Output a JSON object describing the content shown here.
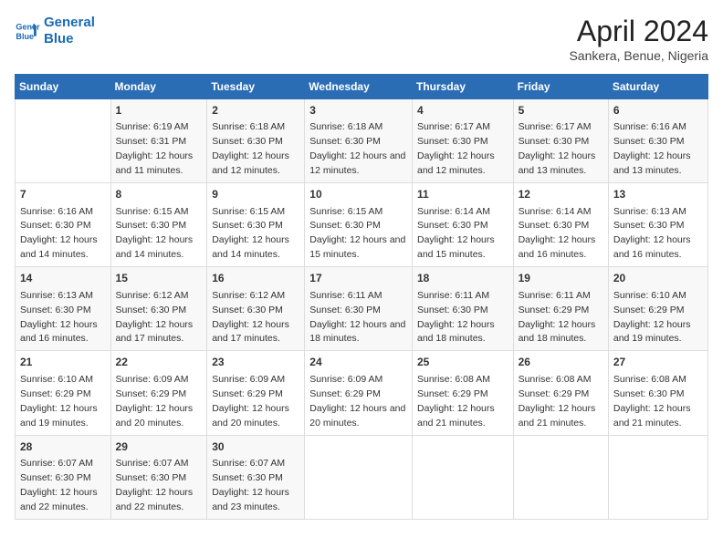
{
  "header": {
    "logo_line1": "General",
    "logo_line2": "Blue",
    "month": "April 2024",
    "location": "Sankera, Benue, Nigeria"
  },
  "columns": [
    "Sunday",
    "Monday",
    "Tuesday",
    "Wednesday",
    "Thursday",
    "Friday",
    "Saturday"
  ],
  "rows": [
    [
      {
        "day": "",
        "sunrise": "",
        "sunset": "",
        "daylight": ""
      },
      {
        "day": "1",
        "sunrise": "Sunrise: 6:19 AM",
        "sunset": "Sunset: 6:31 PM",
        "daylight": "Daylight: 12 hours and 11 minutes."
      },
      {
        "day": "2",
        "sunrise": "Sunrise: 6:18 AM",
        "sunset": "Sunset: 6:30 PM",
        "daylight": "Daylight: 12 hours and 12 minutes."
      },
      {
        "day": "3",
        "sunrise": "Sunrise: 6:18 AM",
        "sunset": "Sunset: 6:30 PM",
        "daylight": "Daylight: 12 hours and 12 minutes."
      },
      {
        "day": "4",
        "sunrise": "Sunrise: 6:17 AM",
        "sunset": "Sunset: 6:30 PM",
        "daylight": "Daylight: 12 hours and 12 minutes."
      },
      {
        "day": "5",
        "sunrise": "Sunrise: 6:17 AM",
        "sunset": "Sunset: 6:30 PM",
        "daylight": "Daylight: 12 hours and 13 minutes."
      },
      {
        "day": "6",
        "sunrise": "Sunrise: 6:16 AM",
        "sunset": "Sunset: 6:30 PM",
        "daylight": "Daylight: 12 hours and 13 minutes."
      }
    ],
    [
      {
        "day": "7",
        "sunrise": "Sunrise: 6:16 AM",
        "sunset": "Sunset: 6:30 PM",
        "daylight": "Daylight: 12 hours and 14 minutes."
      },
      {
        "day": "8",
        "sunrise": "Sunrise: 6:15 AM",
        "sunset": "Sunset: 6:30 PM",
        "daylight": "Daylight: 12 hours and 14 minutes."
      },
      {
        "day": "9",
        "sunrise": "Sunrise: 6:15 AM",
        "sunset": "Sunset: 6:30 PM",
        "daylight": "Daylight: 12 hours and 14 minutes."
      },
      {
        "day": "10",
        "sunrise": "Sunrise: 6:15 AM",
        "sunset": "Sunset: 6:30 PM",
        "daylight": "Daylight: 12 hours and 15 minutes."
      },
      {
        "day": "11",
        "sunrise": "Sunrise: 6:14 AM",
        "sunset": "Sunset: 6:30 PM",
        "daylight": "Daylight: 12 hours and 15 minutes."
      },
      {
        "day": "12",
        "sunrise": "Sunrise: 6:14 AM",
        "sunset": "Sunset: 6:30 PM",
        "daylight": "Daylight: 12 hours and 16 minutes."
      },
      {
        "day": "13",
        "sunrise": "Sunrise: 6:13 AM",
        "sunset": "Sunset: 6:30 PM",
        "daylight": "Daylight: 12 hours and 16 minutes."
      }
    ],
    [
      {
        "day": "14",
        "sunrise": "Sunrise: 6:13 AM",
        "sunset": "Sunset: 6:30 PM",
        "daylight": "Daylight: 12 hours and 16 minutes."
      },
      {
        "day": "15",
        "sunrise": "Sunrise: 6:12 AM",
        "sunset": "Sunset: 6:30 PM",
        "daylight": "Daylight: 12 hours and 17 minutes."
      },
      {
        "day": "16",
        "sunrise": "Sunrise: 6:12 AM",
        "sunset": "Sunset: 6:30 PM",
        "daylight": "Daylight: 12 hours and 17 minutes."
      },
      {
        "day": "17",
        "sunrise": "Sunrise: 6:11 AM",
        "sunset": "Sunset: 6:30 PM",
        "daylight": "Daylight: 12 hours and 18 minutes."
      },
      {
        "day": "18",
        "sunrise": "Sunrise: 6:11 AM",
        "sunset": "Sunset: 6:30 PM",
        "daylight": "Daylight: 12 hours and 18 minutes."
      },
      {
        "day": "19",
        "sunrise": "Sunrise: 6:11 AM",
        "sunset": "Sunset: 6:29 PM",
        "daylight": "Daylight: 12 hours and 18 minutes."
      },
      {
        "day": "20",
        "sunrise": "Sunrise: 6:10 AM",
        "sunset": "Sunset: 6:29 PM",
        "daylight": "Daylight: 12 hours and 19 minutes."
      }
    ],
    [
      {
        "day": "21",
        "sunrise": "Sunrise: 6:10 AM",
        "sunset": "Sunset: 6:29 PM",
        "daylight": "Daylight: 12 hours and 19 minutes."
      },
      {
        "day": "22",
        "sunrise": "Sunrise: 6:09 AM",
        "sunset": "Sunset: 6:29 PM",
        "daylight": "Daylight: 12 hours and 20 minutes."
      },
      {
        "day": "23",
        "sunrise": "Sunrise: 6:09 AM",
        "sunset": "Sunset: 6:29 PM",
        "daylight": "Daylight: 12 hours and 20 minutes."
      },
      {
        "day": "24",
        "sunrise": "Sunrise: 6:09 AM",
        "sunset": "Sunset: 6:29 PM",
        "daylight": "Daylight: 12 hours and 20 minutes."
      },
      {
        "day": "25",
        "sunrise": "Sunrise: 6:08 AM",
        "sunset": "Sunset: 6:29 PM",
        "daylight": "Daylight: 12 hours and 21 minutes."
      },
      {
        "day": "26",
        "sunrise": "Sunrise: 6:08 AM",
        "sunset": "Sunset: 6:29 PM",
        "daylight": "Daylight: 12 hours and 21 minutes."
      },
      {
        "day": "27",
        "sunrise": "Sunrise: 6:08 AM",
        "sunset": "Sunset: 6:30 PM",
        "daylight": "Daylight: 12 hours and 21 minutes."
      }
    ],
    [
      {
        "day": "28",
        "sunrise": "Sunrise: 6:07 AM",
        "sunset": "Sunset: 6:30 PM",
        "daylight": "Daylight: 12 hours and 22 minutes."
      },
      {
        "day": "29",
        "sunrise": "Sunrise: 6:07 AM",
        "sunset": "Sunset: 6:30 PM",
        "daylight": "Daylight: 12 hours and 22 minutes."
      },
      {
        "day": "30",
        "sunrise": "Sunrise: 6:07 AM",
        "sunset": "Sunset: 6:30 PM",
        "daylight": "Daylight: 12 hours and 23 minutes."
      },
      {
        "day": "",
        "sunrise": "",
        "sunset": "",
        "daylight": ""
      },
      {
        "day": "",
        "sunrise": "",
        "sunset": "",
        "daylight": ""
      },
      {
        "day": "",
        "sunrise": "",
        "sunset": "",
        "daylight": ""
      },
      {
        "day": "",
        "sunrise": "",
        "sunset": "",
        "daylight": ""
      }
    ]
  ]
}
